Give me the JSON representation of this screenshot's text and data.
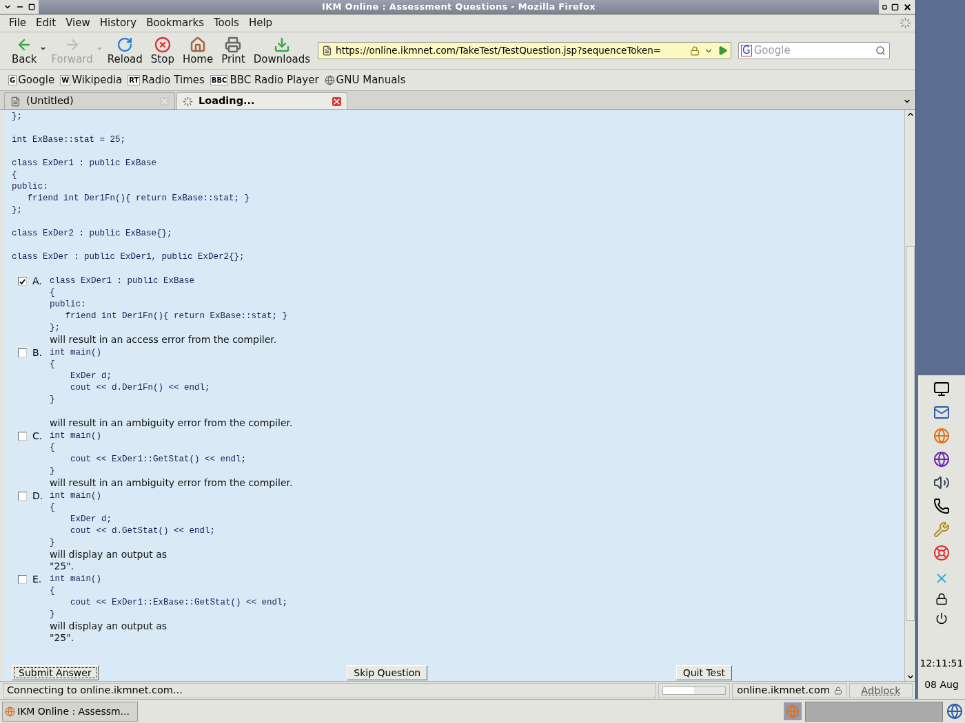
{
  "window": {
    "title": "IKM Online : Assessment Questions - Mozilla Firefox"
  },
  "menu": [
    "File",
    "Edit",
    "View",
    "History",
    "Bookmarks",
    "Tools",
    "Help"
  ],
  "toolbar": [
    {
      "kind": "back",
      "label": "Back",
      "disabled": false,
      "has_menu": true
    },
    {
      "kind": "forward",
      "label": "Forward",
      "disabled": true,
      "has_menu": true
    },
    {
      "kind": "reload",
      "label": "Reload",
      "disabled": false,
      "has_menu": false
    },
    {
      "kind": "stop",
      "label": "Stop",
      "disabled": false,
      "has_menu": false
    },
    {
      "kind": "home",
      "label": "Home",
      "disabled": false,
      "has_menu": false
    },
    {
      "kind": "print",
      "label": "Print",
      "disabled": false,
      "has_menu": false
    },
    {
      "kind": "downloads",
      "label": "Downloads",
      "disabled": false,
      "has_menu": false
    }
  ],
  "address_bar": {
    "value": "https://online.ikmnet.com/TakeTest/TestQuestion.jsp?sequenceToken="
  },
  "search": {
    "engine_letter": "G",
    "placeholder": "Google"
  },
  "bookmarks": [
    {
      "badge": "G",
      "label": "Google"
    },
    {
      "badge": "W",
      "label": "Wikipedia"
    },
    {
      "badge": "RT",
      "label": "Radio Times"
    },
    {
      "badge": "BBC",
      "label": "BBC Radio Player"
    },
    {
      "label": "GNU Manuals"
    }
  ],
  "tabs": [
    {
      "label": "(Untitled)",
      "selected": false,
      "loading": false
    },
    {
      "label": "Loading...",
      "selected": true,
      "loading": true
    }
  ],
  "page": {
    "code_blocks": [
      [
        "};"
      ],
      [
        "int ExBase::stat = 25;"
      ],
      [
        "class ExDer1 : public ExBase",
        "{",
        "public:",
        "   friend int Der1Fn(){ return ExBase::stat; }",
        "};"
      ],
      [
        "class ExDer2 : public ExBase{};"
      ],
      [
        "class ExDer : public ExDer1, public ExDer2{};"
      ]
    ],
    "answers": [
      {
        "letter": "A.",
        "checked": true,
        "code": [
          "class ExDer1 : public ExBase",
          "{",
          "public:",
          "   friend int Der1Fn(){ return ExBase::stat; }",
          "};"
        ],
        "gap_before_text": false,
        "text": [
          "will result in an access error from the compiler."
        ]
      },
      {
        "letter": "B.",
        "checked": false,
        "code": [
          "int main()",
          "{",
          "    ExDer d;",
          "    cout << d.Der1Fn() << endl;",
          "}"
        ],
        "gap_before_text": true,
        "text": [
          "will result in an ambiguity error from the compiler."
        ]
      },
      {
        "letter": "C.",
        "checked": false,
        "code": [
          "int main()",
          "{",
          "    cout << ExDer1::GetStat() << endl;",
          "}"
        ],
        "gap_before_text": false,
        "text": [
          "will result in an ambiguity error from the compiler."
        ]
      },
      {
        "letter": "D.",
        "checked": false,
        "code": [
          "int main()",
          "{",
          "    ExDer d;",
          "    cout << d.GetStat() << endl;",
          "}"
        ],
        "gap_before_text": false,
        "text": [
          "will display an output as",
          "\"25\"."
        ]
      },
      {
        "letter": "E.",
        "checked": false,
        "code": [
          "int main()",
          "{",
          "    cout << ExDer1::ExBase::GetStat() << endl;",
          "}"
        ],
        "gap_before_text": false,
        "text": [
          "will display an output as",
          "\"25\"."
        ]
      }
    ],
    "buttons": [
      {
        "label": "Submit Answer",
        "focused": true
      },
      {
        "label": "Skip Question",
        "focused": false
      },
      {
        "label": "Quit Test",
        "focused": false
      }
    ]
  },
  "status_bar": {
    "message": "Connecting to online.ikmnet.com...",
    "progress": {
      "level": 0.5
    },
    "host": "online.ikmnet.com",
    "addon": "Adblock"
  },
  "taskbar": {
    "task": "IKM Online : Assessm..."
  },
  "side_panel": {
    "time": "12:11:51",
    "date": "08 Aug"
  }
}
